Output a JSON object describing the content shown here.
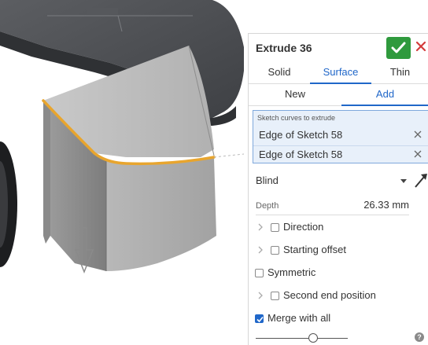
{
  "feature": {
    "title": "Extrude 36"
  },
  "tabs_type": [
    {
      "label": "Solid",
      "active": false
    },
    {
      "label": "Surface",
      "active": true
    },
    {
      "label": "Thin",
      "active": false
    }
  ],
  "tabs_op": [
    {
      "label": "New",
      "active": false
    },
    {
      "label": "Add",
      "active": true
    }
  ],
  "selection": {
    "hint": "Sketch curves to extrude",
    "items": [
      "Edge of Sketch 58",
      "Edge of Sketch 58"
    ]
  },
  "end_type": {
    "value": "Blind"
  },
  "depth": {
    "label": "Depth",
    "value": "26.33 mm"
  },
  "options": {
    "direction": {
      "label": "Direction",
      "checked": false
    },
    "starting_offset": {
      "label": "Starting offset",
      "checked": false
    },
    "symmetric": {
      "label": "Symmetric",
      "checked": false
    },
    "second_end": {
      "label": "Second end position",
      "checked": false
    },
    "merge": {
      "label": "Merge with all",
      "checked": true
    }
  },
  "slider": {
    "fraction": 0.62
  },
  "colors": {
    "accent": "#2067c9",
    "ok_green": "#2f9a3d",
    "cancel_red": "#d33b3b",
    "highlight_edge": "#e8a52e",
    "selection_bg": "#e8f0fa"
  }
}
